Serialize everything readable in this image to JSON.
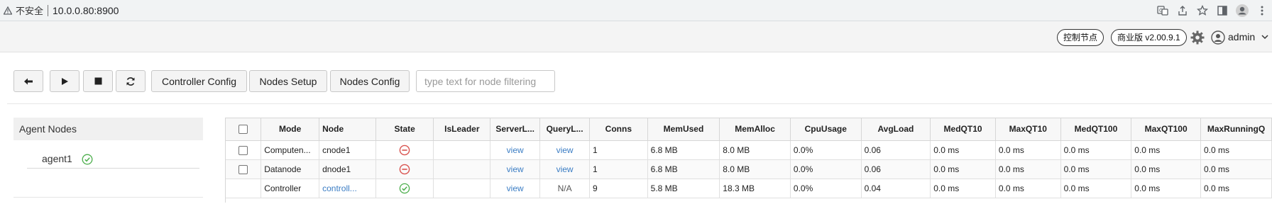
{
  "browser": {
    "insecure_label": "不安全",
    "url": "10.0.0.80:8900"
  },
  "header": {
    "control_node_label": "控制节点",
    "edition_label": "商业版 v2.00.9.1",
    "user_label": "admin"
  },
  "toolbar": {
    "controller_config_label": "Controller Config",
    "nodes_setup_label": "Nodes Setup",
    "nodes_config_label": "Nodes Config",
    "filter_placeholder": "type text for node filtering"
  },
  "agent_panel": {
    "title": "Agent Nodes",
    "agents": [
      {
        "name": "agent1",
        "status": "online"
      }
    ]
  },
  "table": {
    "columns": [
      "Mode",
      "Node",
      "State",
      "IsLeader",
      "ServerL...",
      "QueryL...",
      "Conns",
      "MemUsed",
      "MemAlloc",
      "CpuUsage",
      "AvgLoad",
      "MedQT10",
      "MaxQT10",
      "MedQT100",
      "MaxQT100",
      "MaxRunningQ"
    ],
    "rows": [
      {
        "mode": "Computen...",
        "node": "cnode1",
        "state": "stopped",
        "is_leader": "",
        "server_log": "view",
        "query_log": "view",
        "conns": "1",
        "mem_used": "6.8 MB",
        "mem_alloc": "8.0 MB",
        "cpu_usage": "0.0%",
        "avg_load": "0.06",
        "med_qt10": "0.0 ms",
        "max_qt10": "0.0 ms",
        "med_qt100": "0.0 ms",
        "max_qt100": "0.0 ms",
        "max_running_q": "0.0 ms"
      },
      {
        "mode": "Datanode",
        "node": "dnode1",
        "state": "stopped",
        "is_leader": "",
        "server_log": "view",
        "query_log": "view",
        "conns": "1",
        "mem_used": "6.8 MB",
        "mem_alloc": "8.0 MB",
        "cpu_usage": "0.0%",
        "avg_load": "0.06",
        "med_qt10": "0.0 ms",
        "max_qt10": "0.0 ms",
        "med_qt100": "0.0 ms",
        "max_qt100": "0.0 ms",
        "max_running_q": "0.0 ms"
      },
      {
        "mode": "Controller",
        "node": "controll...",
        "state": "running",
        "is_leader": "",
        "server_log": "view",
        "query_log": "N/A",
        "conns": "9",
        "mem_used": "5.8 MB",
        "mem_alloc": "18.3 MB",
        "cpu_usage": "0.0%",
        "avg_load": "0.04",
        "med_qt10": "0.0 ms",
        "max_qt10": "0.0 ms",
        "med_qt100": "0.0 ms",
        "max_qt100": "0.0 ms",
        "max_running_q": "0.0 ms"
      }
    ]
  },
  "colors": {
    "stopped": "#d9534f",
    "running": "#4cae4c",
    "link": "#3b7dc4"
  }
}
